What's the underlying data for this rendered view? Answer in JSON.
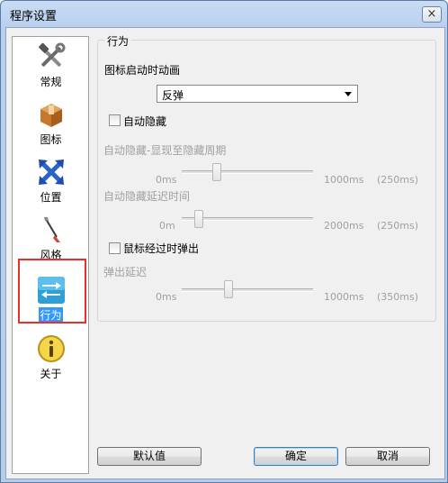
{
  "window": {
    "title": "程序设置",
    "close_glyph": "×"
  },
  "sidebar": {
    "items": [
      {
        "label": "常规",
        "icon": "tools-icon"
      },
      {
        "label": "图标",
        "icon": "box-icon"
      },
      {
        "label": "位置",
        "icon": "move-arrows-icon"
      },
      {
        "label": "风格",
        "icon": "brush-icon"
      },
      {
        "label": "行为",
        "icon": "swap-arrows-icon",
        "active": true
      },
      {
        "label": "关于",
        "icon": "info-icon"
      }
    ]
  },
  "group": {
    "title": "行为",
    "icon_anim_label": "图标启动时动画",
    "icon_anim_value": "反弹",
    "auto_hide_label": "自动隐藏",
    "auto_hide_checked": false,
    "period": {
      "label": "自动隐藏-显现至隐藏周期",
      "min": "0ms",
      "max": "1000ms",
      "value": "(250ms)"
    },
    "delay": {
      "label": "自动隐藏延迟时间",
      "min": "0m",
      "max": "2000ms",
      "value": "(250ms)"
    },
    "hover_popup_label": "鼠标经过时弹出",
    "hover_popup_checked": false,
    "popup_delay": {
      "label": "弹出延迟",
      "min": "0ms",
      "max": "1000ms",
      "value": "(350ms)"
    }
  },
  "buttons": {
    "defaults": "默认值",
    "ok": "确定",
    "cancel": "取消"
  },
  "colors": {
    "selection": "#3399ff",
    "highlight_frame": "#e8302a"
  }
}
